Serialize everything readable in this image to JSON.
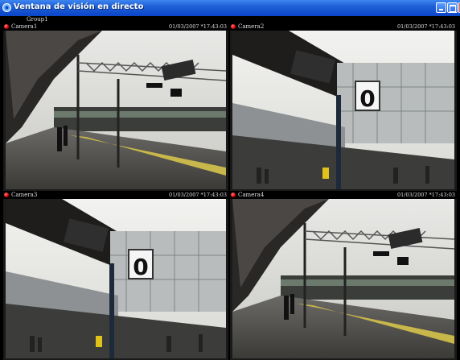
{
  "window": {
    "title": "Ventana de visión en directo",
    "group": "Group1"
  },
  "cameras": [
    {
      "name": "Camera1",
      "timestamp": "01/03/2007 *17:43:03",
      "view": "platform"
    },
    {
      "name": "Camera2",
      "timestamp": "01/03/2007 *17:43:03",
      "view": "sign"
    },
    {
      "name": "Camera3",
      "timestamp": "01/03/2007 *17:43:03",
      "view": "sign"
    },
    {
      "name": "Camera4",
      "timestamp": "01/03/2007 *17:43:03",
      "view": "platform"
    }
  ],
  "colors": {
    "titlebar": "#1f5fd6",
    "record_indicator": "#d90000",
    "background": "#000000"
  }
}
